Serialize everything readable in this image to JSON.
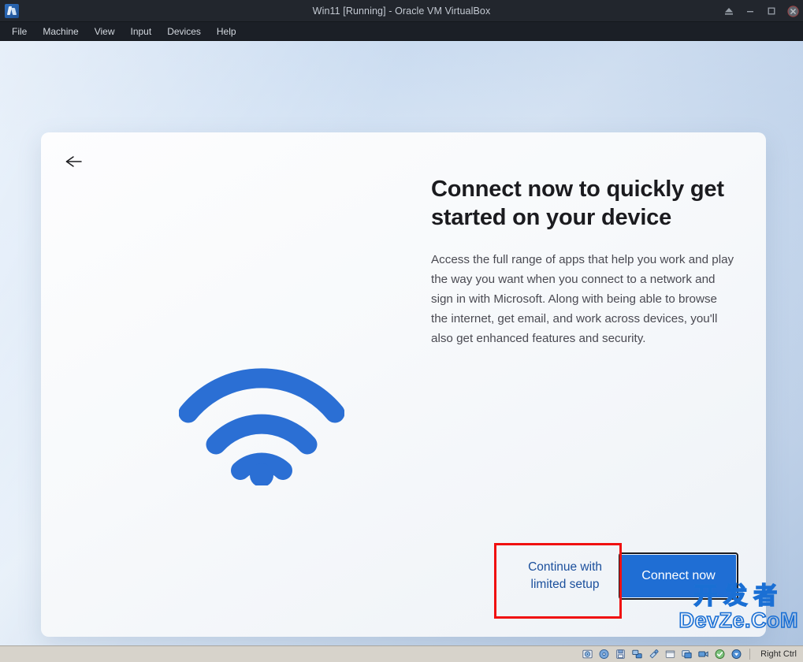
{
  "window": {
    "title": "Win11 [Running] - Oracle VM VirtualBox",
    "logo_icon": "virtualbox-logo-icon",
    "controls": [
      {
        "name": "eject-button",
        "icon": "eject-icon"
      },
      {
        "name": "minimize-button",
        "icon": "minimize-icon"
      },
      {
        "name": "restore-button",
        "icon": "restore-icon"
      },
      {
        "name": "close-button",
        "icon": "close-icon"
      }
    ]
  },
  "menubar": {
    "items": [
      {
        "label": "File"
      },
      {
        "label": "Machine"
      },
      {
        "label": "View"
      },
      {
        "label": "Input"
      },
      {
        "label": "Devices"
      },
      {
        "label": "Help"
      }
    ]
  },
  "oobe": {
    "back_icon": "back-arrow-icon",
    "illustration_icon": "wifi-icon",
    "heading": "Connect now to quickly get started on your device",
    "body": "Access the full range of apps that help you work and play the way you want when you connect to a network and sign in with Microsoft. Along with being able to browse the internet, get email, and work across devices, you'll also get enhanced features and security.",
    "secondary_action": "Continue with\nlimited setup",
    "primary_action": "Connect now"
  },
  "annotation": {
    "shape": "rectangle",
    "color": "#f01010",
    "targets": "secondary-action-link"
  },
  "watermark": {
    "line1": "开发者",
    "line2": "DevZe.CoM",
    "color": "#1a6fd4"
  },
  "statusbar": {
    "icons": [
      {
        "name": "hard-disk-icon"
      },
      {
        "name": "optical-disc-icon"
      },
      {
        "name": "floppy-disk-icon"
      },
      {
        "name": "network-icon"
      },
      {
        "name": "usb-icon"
      },
      {
        "name": "shared-folder-icon"
      },
      {
        "name": "display-icon"
      },
      {
        "name": "recording-icon"
      },
      {
        "name": "mouse-integration-icon"
      },
      {
        "name": "keyboard-icon"
      }
    ],
    "host_key": "Right Ctrl"
  },
  "colors": {
    "accent": "#1f6ed4",
    "link": "#1b4f9c",
    "annotation": "#f01010",
    "titlebar": "#22262d",
    "backdrop": "#cfe0f4"
  }
}
